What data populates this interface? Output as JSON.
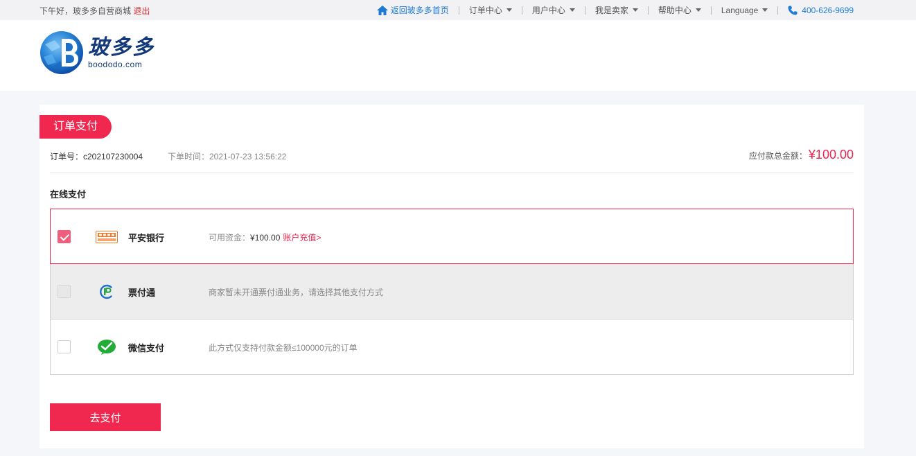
{
  "topbar": {
    "greeting": "下午好，玻多多自营商城",
    "logout": "退出",
    "nav": {
      "home": "返回玻多多首页",
      "orders": "订单中心",
      "user": "用户中心",
      "seller": "我是卖家",
      "help": "帮助中心",
      "language": "Language",
      "phone": "400-626-9699"
    }
  },
  "header": {
    "logo_cn": "玻多多",
    "logo_en": "boododo.com"
  },
  "payment": {
    "tag": "订单支付",
    "order_no": "订单号：c202107230004",
    "order_time": "下单时间：2021-07-23 13:56:22",
    "total_label": "应付款总金额：",
    "total_amount": "¥100.00",
    "section_title": "在线支付",
    "methods": [
      {
        "name": "平安银行",
        "desc_prefix": "可用资金：",
        "desc_money": "¥100.00",
        "desc_link": "账户充值>",
        "checked": true
      },
      {
        "name": "票付通",
        "desc": "商家暂未开通票付通业务，请选择其他支付方式",
        "disabled": true
      },
      {
        "name": "微信支付",
        "desc": "此方式仅支持付款金额≤100000元的订单"
      }
    ],
    "pay_button": "去支付"
  },
  "colors": {
    "accent": "#f0284f",
    "link": "#1d7bd6",
    "brand": "#14397a"
  }
}
